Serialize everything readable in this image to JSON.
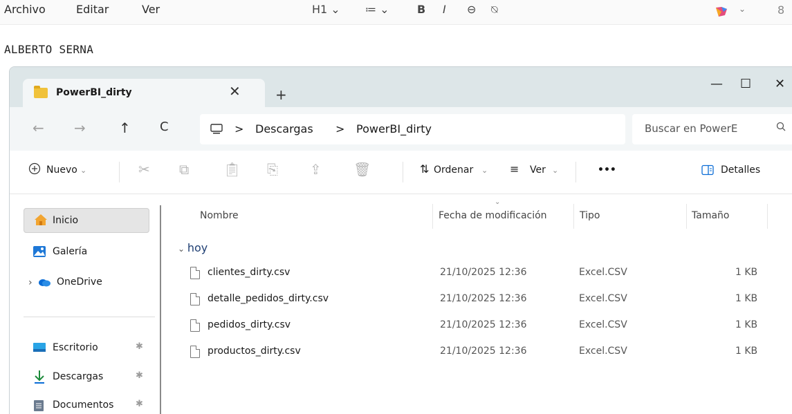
{
  "editor": {
    "menu": [
      "Archivo",
      "Editar",
      "Ver"
    ],
    "heading_btn": "H1 ⌄",
    "list_btn": "≔ ⌄",
    "bold": "B",
    "italic": "I",
    "link_icon": "⊖",
    "clear_format_icon": "⍉",
    "doc_name": "ALBERTO SERNA",
    "avatar_glyph": "8"
  },
  "explorer": {
    "tab_title": "PowerBI_dirty",
    "tab_close": "✕",
    "new_tab": "+",
    "window": {
      "minimize": "—",
      "maximize": "☐",
      "close": "✕"
    },
    "nav": {
      "back": "←",
      "forward": "→",
      "up": "↑",
      "refresh": "C"
    },
    "breadcrumb": [
      "Descargas",
      "PowerBI_dirty"
    ],
    "breadcrumb_sep": ">",
    "search_placeholder": "Buscar en PowerE",
    "toolbar": {
      "new_label": "Nuevo",
      "sort_label": "Ordenar",
      "view_label": "Ver",
      "more_label": "•••",
      "details_label": "Detalles"
    },
    "sidebar": [
      {
        "label": "Inicio",
        "icon": "home-icon",
        "active": true
      },
      {
        "label": "Galería",
        "icon": "gallery-icon"
      },
      {
        "label": "OneDrive",
        "icon": "cloud-icon"
      },
      {
        "label": "Escritorio",
        "icon": "desktop-icon",
        "pinned": true
      },
      {
        "label": "Descargas",
        "icon": "download-icon",
        "pinned": true
      },
      {
        "label": "Documentos",
        "icon": "documents-icon",
        "pinned": true
      }
    ],
    "columns": [
      "Nombre",
      "Fecha de modificación",
      "Tipo",
      "Tamaño"
    ],
    "group_label": "hoy",
    "files": [
      {
        "name": "clientes_dirty.csv",
        "date": "21/10/2025 12:36",
        "type": "Excel.CSV",
        "size": "1 KB"
      },
      {
        "name": "detalle_pedidos_dirty.csv",
        "date": "21/10/2025 12:36",
        "type": "Excel.CSV",
        "size": "1 KB"
      },
      {
        "name": "pedidos_dirty.csv",
        "date": "21/10/2025 12:36",
        "type": "Excel.CSV",
        "size": "1 KB"
      },
      {
        "name": "productos_dirty.csv",
        "date": "21/10/2025 12:36",
        "type": "Excel.CSV",
        "size": "1 KB"
      }
    ]
  },
  "colors": {
    "titlebar": "#dde6e8",
    "folder": "#f0c23b",
    "accent_blue": "#0a6cd6",
    "group_text": "#1f3f73"
  }
}
